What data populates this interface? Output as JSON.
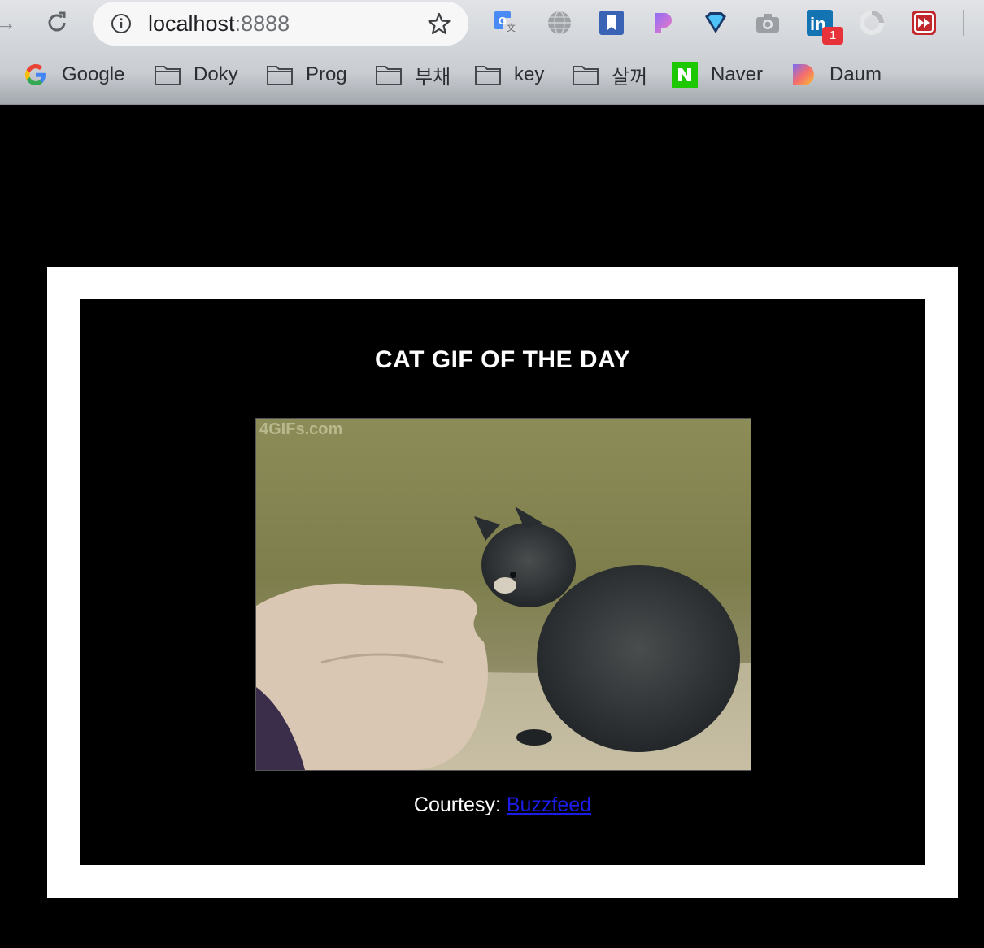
{
  "browser": {
    "url_host": "localhost",
    "url_port": ":8888",
    "extensions": [
      "google-translate-icon",
      "globe-icon",
      "bookmark-icon",
      "gradient-p-icon",
      "diamond-icon",
      "camera-icon",
      "linkedin-icon",
      "refresh-circle-icon",
      "fast-forward-icon"
    ],
    "linkedin_logo": "in",
    "linkedin_badge": "1",
    "bookmarks": [
      {
        "label": "Google",
        "icon": "google-icon"
      },
      {
        "label": "Doky",
        "icon": "folder-icon"
      },
      {
        "label": "Prog",
        "icon": "folder-icon"
      },
      {
        "label": "부채",
        "icon": "folder-icon"
      },
      {
        "label": "key",
        "icon": "folder-icon"
      },
      {
        "label": "살꺼",
        "icon": "folder-icon"
      },
      {
        "label": "Naver",
        "icon": "naver-icon"
      },
      {
        "label": "Daum",
        "icon": "daum-icon"
      }
    ]
  },
  "page": {
    "title": "CAT GIF OF THE DAY",
    "gif_watermark": "4GIFs.com",
    "courtesy_label": "Courtesy: ",
    "courtesy_link": "Buzzfeed"
  },
  "colors": {
    "page_background": "#000000",
    "frame_border": "#ffffff",
    "link": "#1c1ce8"
  }
}
